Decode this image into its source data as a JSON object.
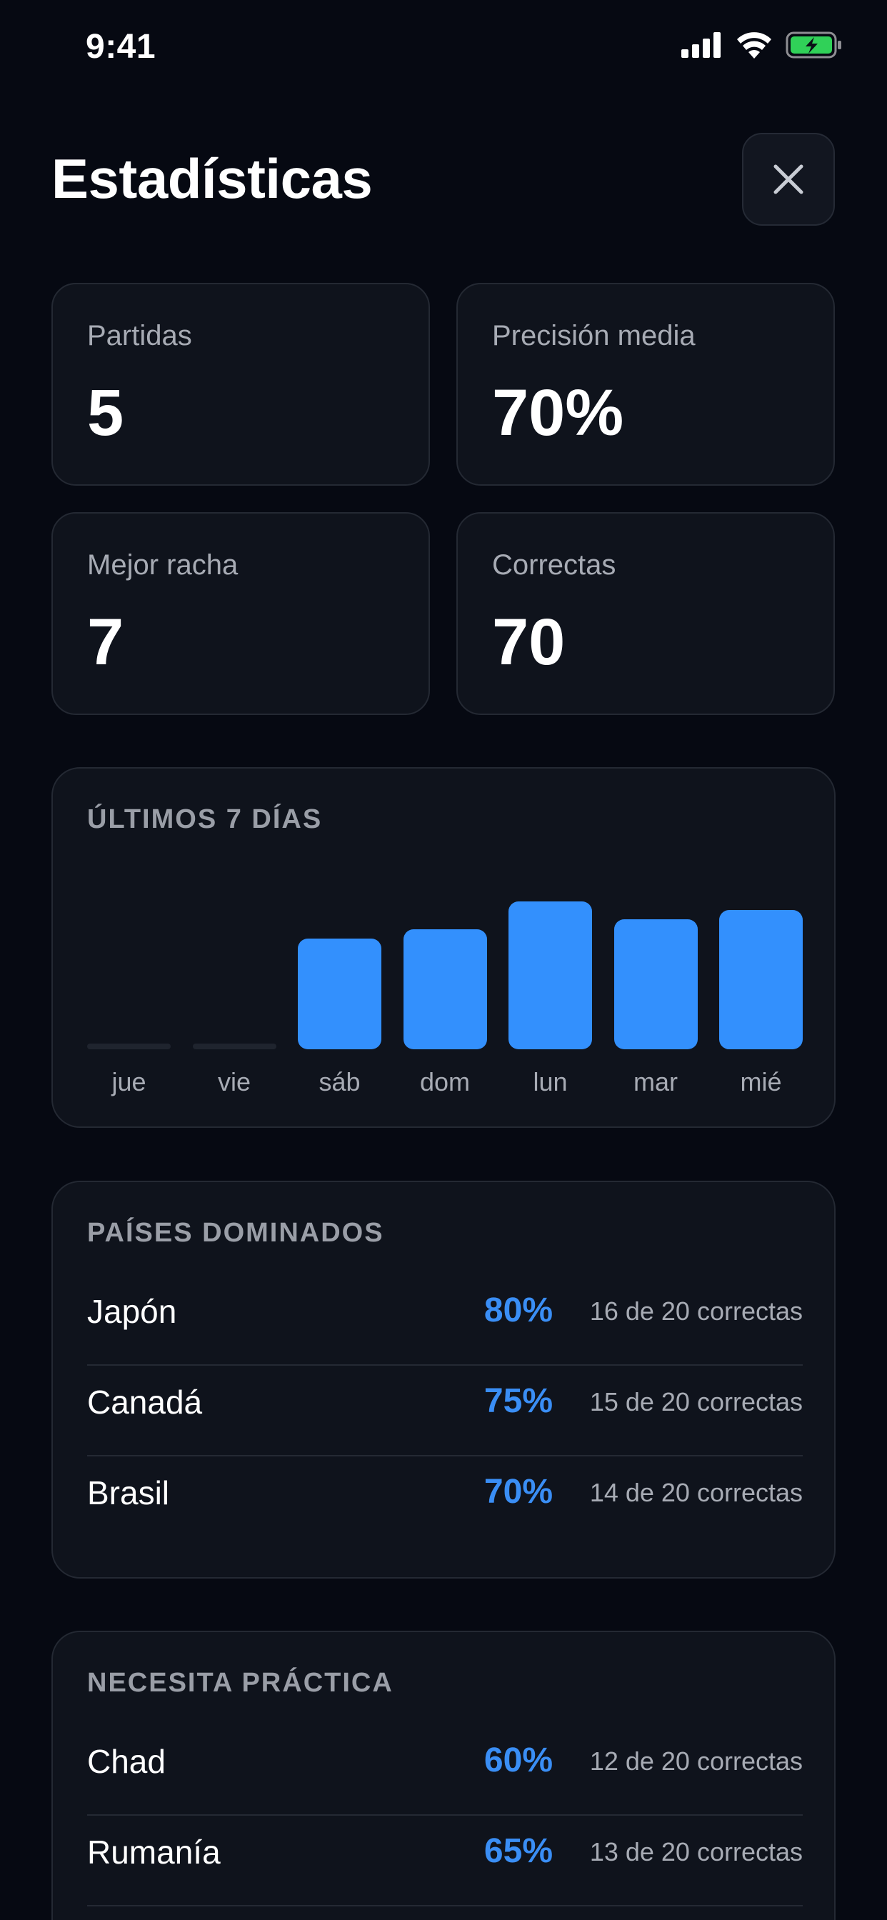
{
  "status": {
    "time": "9:41"
  },
  "title": "Estadísticas",
  "stats": [
    {
      "label": "Partidas",
      "value": "5"
    },
    {
      "label": "Precisión media",
      "value": "70%"
    },
    {
      "label": "Mejor racha",
      "value": "7"
    },
    {
      "label": "Correctas",
      "value": "70"
    }
  ],
  "last7": {
    "title": "ÚLTIMOS 7 DÍAS",
    "days": [
      "jue",
      "vie",
      "sáb",
      "dom",
      "lun",
      "mar",
      "mié"
    ]
  },
  "chart_data": {
    "type": "bar",
    "title": "ÚLTIMOS 7 DÍAS",
    "categories": [
      "jue",
      "vie",
      "sáb",
      "dom",
      "lun",
      "mar",
      "mié"
    ],
    "values": [
      0,
      0,
      0.75,
      0.81,
      1.0,
      0.88,
      0.94
    ],
    "colors": {
      "bar": "#3390fd",
      "empty": "#1f242e"
    }
  },
  "dominated": {
    "title": "PAÍSES DOMINADOS",
    "rows": [
      {
        "name": "Japón",
        "pct": "80%",
        "count": "16 de 20 correctas"
      },
      {
        "name": "Canadá",
        "pct": "75%",
        "count": "15 de 20 correctas"
      },
      {
        "name": "Brasil",
        "pct": "70%",
        "count": "14 de 20 correctas"
      }
    ]
  },
  "practice": {
    "title": "NECESITA PRÁCTICA",
    "rows": [
      {
        "name": "Chad",
        "pct": "60%",
        "count": "12 de 20 correctas"
      },
      {
        "name": "Rumanía",
        "pct": "65%",
        "count": "13 de 20 correctas"
      }
    ]
  },
  "colors": {
    "accent": "#3390fd",
    "background": "#060912",
    "card": "#0f131c",
    "battery": "#30d158"
  }
}
